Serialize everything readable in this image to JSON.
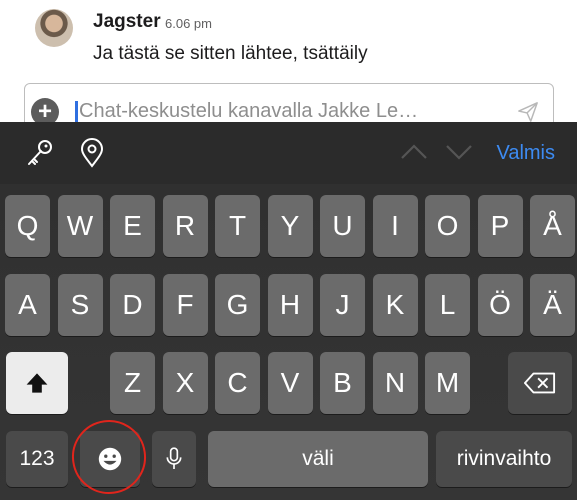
{
  "message": {
    "author": "Jagster",
    "time": "6.06 pm",
    "text": "Ja tästä se sitten lähtee, tsättäily"
  },
  "composer": {
    "placeholder": "Chat-keskustelu kanavalla Jakke Le…",
    "plus_icon": "plus-icon",
    "send_icon": "send-icon"
  },
  "toolbar": {
    "key_icon": "key-icon",
    "location_icon": "location-pin-icon",
    "done_label": "Valmis",
    "accent": "#3d8bf2"
  },
  "keyboard": {
    "row1": [
      "Q",
      "W",
      "E",
      "R",
      "T",
      "Y",
      "U",
      "I",
      "O",
      "P",
      "Å"
    ],
    "row2": [
      "A",
      "S",
      "D",
      "F",
      "G",
      "H",
      "J",
      "K",
      "L",
      "Ö",
      "Ä"
    ],
    "row3": [
      "Z",
      "X",
      "C",
      "V",
      "B",
      "N",
      "M"
    ],
    "numbers_label": "123",
    "space_label": "väli",
    "return_label": "rivinvaihto",
    "emoji_icon": "emoji-icon",
    "mic_icon": "microphone-icon",
    "shift_icon": "shift-icon",
    "backspace_icon": "backspace-icon"
  }
}
